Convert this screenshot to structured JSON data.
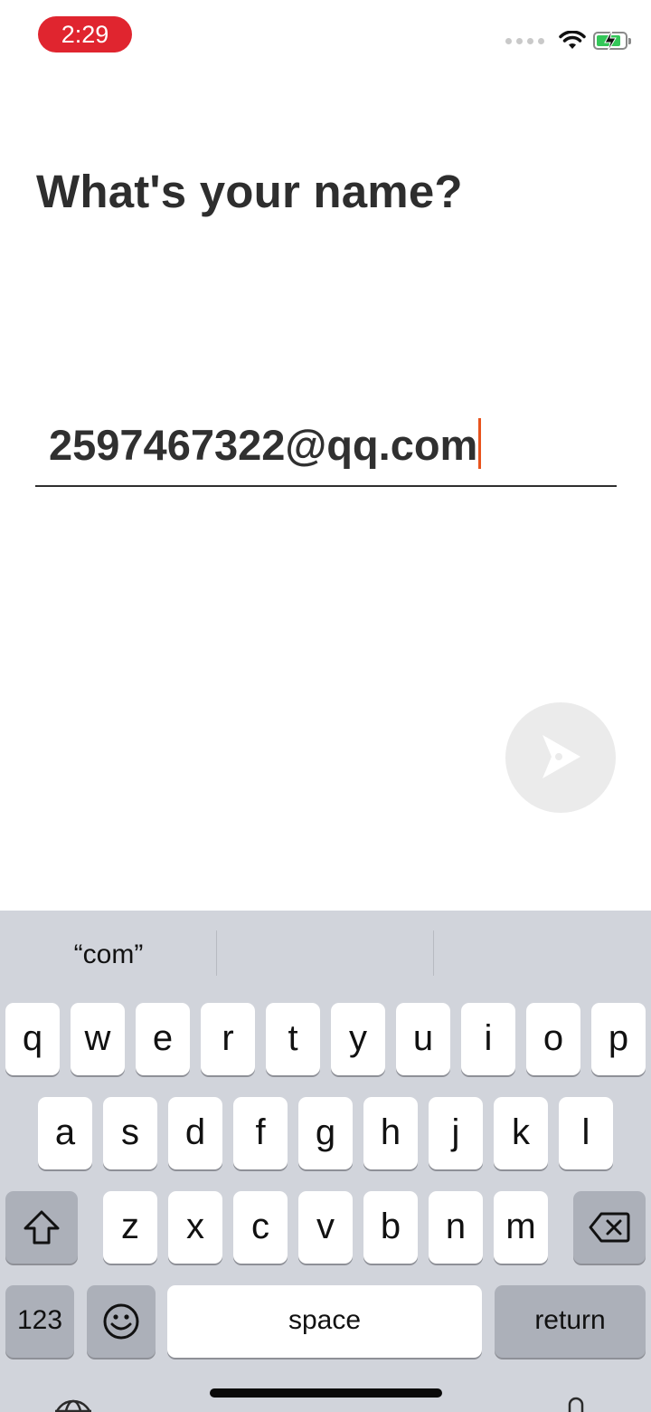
{
  "status_bar": {
    "time": "2:29"
  },
  "main": {
    "title": "What's your name?",
    "input_value": "2597467322@qq.com"
  },
  "keyboard": {
    "suggestions": [
      "“com”",
      "",
      ""
    ],
    "row1": [
      "q",
      "w",
      "e",
      "r",
      "t",
      "y",
      "u",
      "i",
      "o",
      "p"
    ],
    "row2": [
      "a",
      "s",
      "d",
      "f",
      "g",
      "h",
      "j",
      "k",
      "l"
    ],
    "row3": [
      "z",
      "x",
      "c",
      "v",
      "b",
      "n",
      "m"
    ],
    "numbers_label": "123",
    "space_label": "space",
    "return_label": "return"
  },
  "colors": {
    "status_pill": "#e0252f",
    "caret": "#e8531d",
    "keyboard_bg": "#d1d4db",
    "battery": "#34c759"
  },
  "icons": [
    "wifi-icon",
    "battery-icon",
    "send-icon",
    "shift-icon",
    "backspace-icon",
    "emoji-icon",
    "globe-icon",
    "microphone-icon"
  ]
}
